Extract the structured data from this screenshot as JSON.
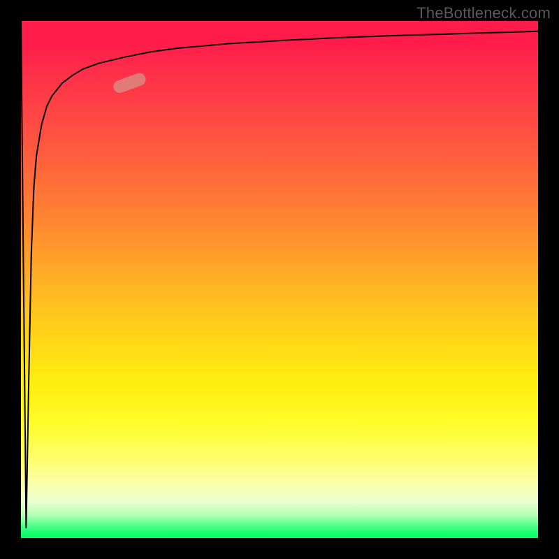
{
  "watermark": "TheBottleneck.com",
  "chart_data": {
    "type": "line",
    "title": "",
    "xlabel": "",
    "ylabel": "",
    "xlim": [
      0,
      100
    ],
    "ylim": [
      0,
      100
    ],
    "grid": false,
    "legend": false,
    "series": [
      {
        "name": "curve",
        "x": [
          0,
          0.5,
          1,
          1.5,
          2,
          2.5,
          3,
          4,
          5,
          6,
          8,
          10,
          12,
          15,
          20,
          25,
          30,
          40,
          50,
          60,
          70,
          80,
          90,
          100
        ],
        "y": [
          100,
          50,
          2,
          30,
          55,
          68,
          74,
          80,
          83.5,
          85.5,
          88,
          89.5,
          90.7,
          91.8,
          93,
          94,
          94.7,
          95.6,
          96.2,
          96.7,
          97.1,
          97.4,
          97.7,
          98
        ]
      }
    ],
    "marker": {
      "x": 21,
      "y": 88,
      "angle_deg": -20
    },
    "background": {
      "gradient": "vertical",
      "stops": [
        {
          "pos": 0.0,
          "color": "#ff1b4a"
        },
        {
          "pos": 0.25,
          "color": "#ff5a3f"
        },
        {
          "pos": 0.55,
          "color": "#ffc21f"
        },
        {
          "pos": 0.78,
          "color": "#fffc2a"
        },
        {
          "pos": 0.955,
          "color": "#b5ffb5"
        },
        {
          "pos": 1.0,
          "color": "#00ff66"
        }
      ]
    }
  }
}
